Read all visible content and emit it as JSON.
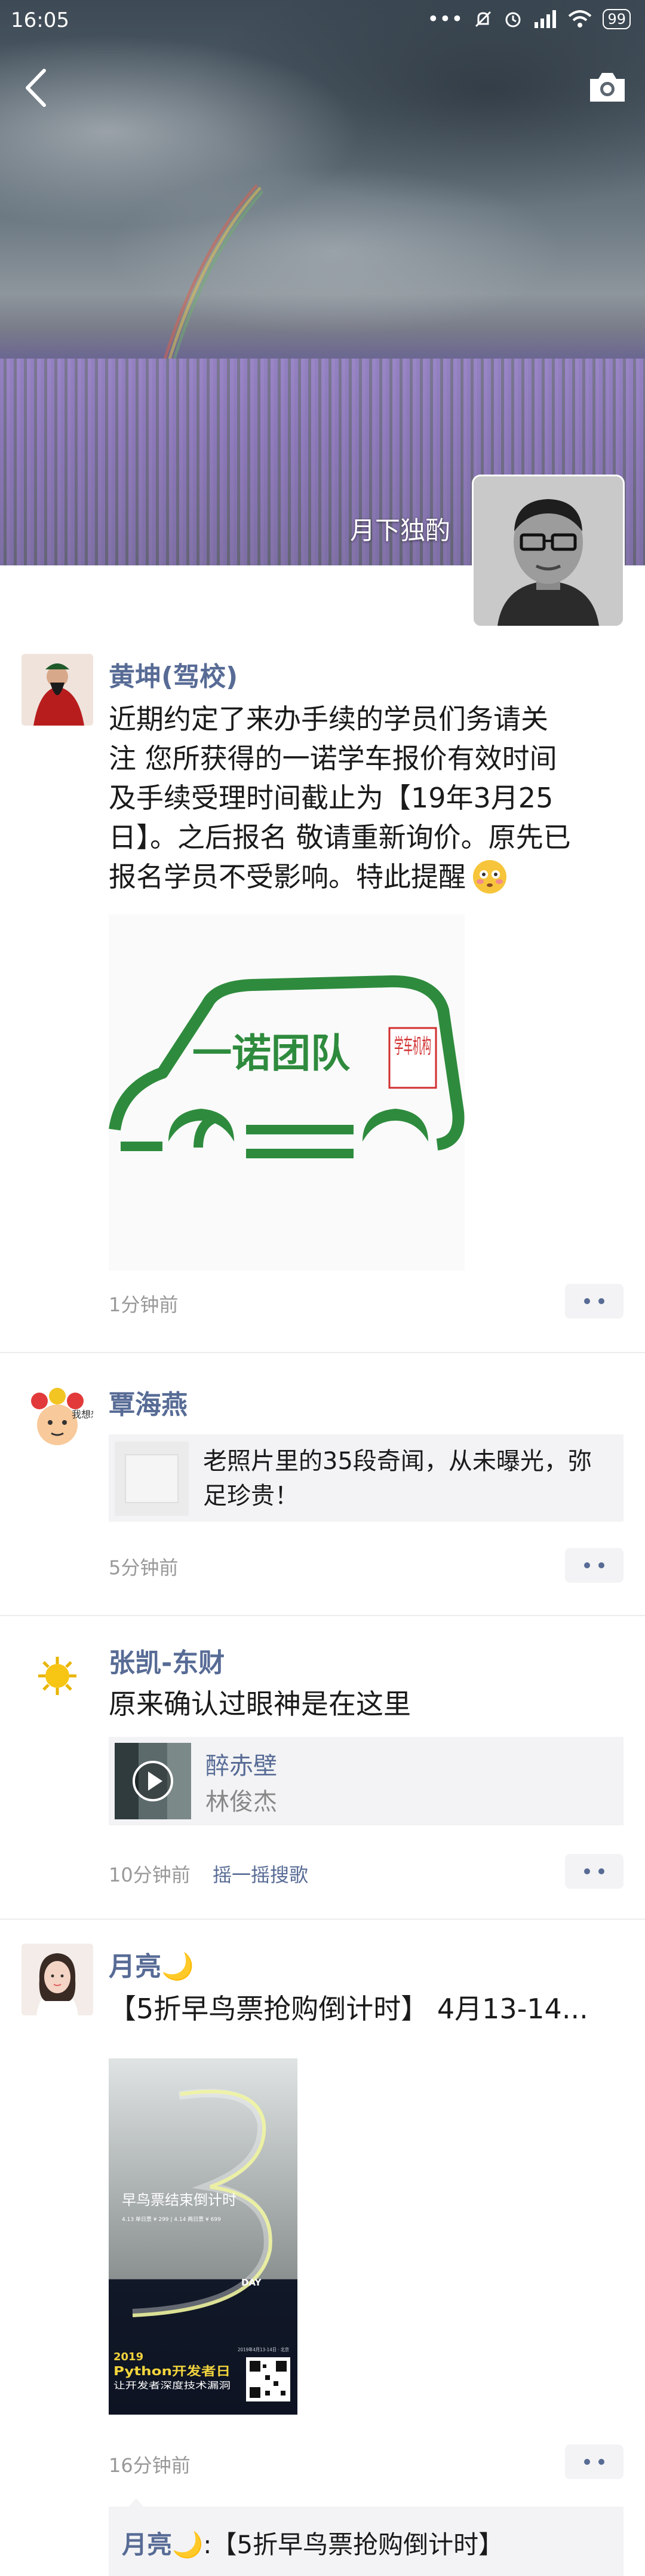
{
  "status_bar": {
    "time": "16:05",
    "battery": "99"
  },
  "cover": {
    "owner_name": "月下独酌"
  },
  "posts": [
    {
      "author": "黄坤(驾校)",
      "text_lines": [
        "近期约定了来办手续的学员们务请关",
        "注 您所获得的一诺学车报价有效时间",
        "及手续受理时间截止为【19年3月25",
        "日】。之后报名 敬请重新询价。原先已",
        "报名学员不受影响。特此提醒"
      ],
      "image": {
        "logo_main": "一诺团队",
        "logo_side": "学车机构"
      },
      "time": "1分钟前"
    },
    {
      "author": "覃海燕",
      "avatar_label": "我想想",
      "link": {
        "title_line1": "老照片里的35段奇闻，从未曝光，弥",
        "title_line2": "足珍贵！"
      },
      "time": "5分钟前"
    },
    {
      "author": "张凯-东财",
      "text": "原来确认过眼神是在这里",
      "music": {
        "title": "醉赤壁",
        "artist": "林俊杰"
      },
      "time": "10分钟前",
      "source": "摇一摇搜歌"
    },
    {
      "author": "月亮🌙",
      "text": "【5折早鸟票抢购倒计时】 4月13-14...",
      "poster": {
        "headline": "早鸟票结束倒计时",
        "price_line": "4.13 单日票 ¥ 299 | 4.14 两日票 ¥ 699",
        "day_label": "DAY",
        "year": "2019",
        "event": "Python开发者日",
        "slogan": "让开发者深度技术漏洞",
        "date_line": "2019年4月13-14日 · 北京"
      },
      "time": "16分钟前",
      "comment": {
        "author": "月亮🌙",
        "text": ":【5折早鸟票抢购倒计时】"
      }
    }
  ]
}
